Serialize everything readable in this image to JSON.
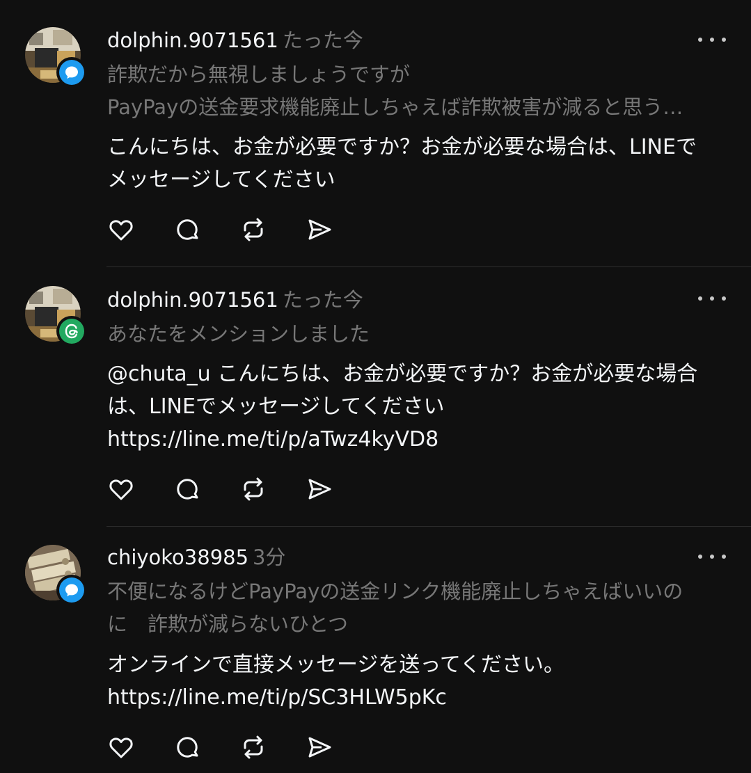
{
  "colors": {
    "background": "#101010",
    "primary_text": "#f3f5f7",
    "secondary_text": "#777777",
    "divider": "#2d2d2d",
    "badge_blue": "#1d9bf0",
    "badge_green": "#22a960"
  },
  "posts": [
    {
      "username": "dolphin.9071561",
      "timestamp": "たった今",
      "badge_icon": "reply-bubble-icon",
      "context_lines": [
        "詐欺だから無視しましょうですが",
        "PayPayの送金要求機能廃止しちゃえば詐欺被害が減ると思う…"
      ],
      "body_lines": [
        "こんにちは、お金が必要ですか？お金が必要な場合は、LINEで",
        "メッセージしてください"
      ]
    },
    {
      "username": "dolphin.9071561",
      "timestamp": "たった今",
      "badge_icon": "threads-mention-icon",
      "context_lines": [
        "あなたをメンションしました"
      ],
      "body_lines": [
        "@chuta_u こんにちは、お金が必要ですか？お金が必要な場合",
        "は、LINEでメッセージしてください",
        "https://line.me/ti/p/aTwz4kyVD8"
      ]
    },
    {
      "username": "chiyoko38985",
      "timestamp": "3分",
      "badge_icon": "reply-bubble-icon",
      "context_lines": [
        "不便になるけどPayPayの送金リンク機能廃止しちゃえばいいの",
        "に　詐欺が減らないひとつ"
      ],
      "body_lines": [
        "オンラインで直接メッセージを送ってください。",
        "https://line.me/ti/p/SC3HLW5pKc￼"
      ]
    }
  ],
  "actions": [
    "heart-icon",
    "comment-icon",
    "repost-icon",
    "share-icon"
  ]
}
